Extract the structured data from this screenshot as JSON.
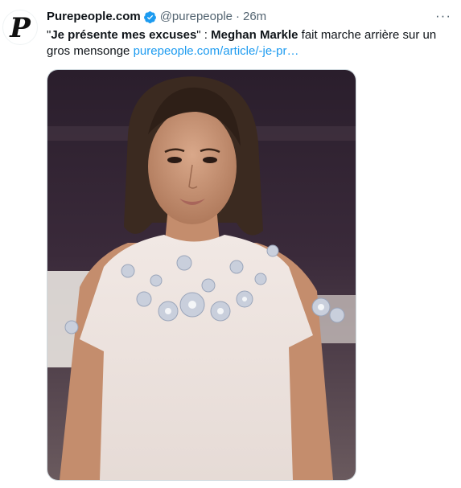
{
  "author": {
    "avatar_letter": "P",
    "display_name": "Purepeople.com",
    "handle": "@purepeople",
    "separator": "·",
    "timestamp": "26m",
    "verified_icon": "verified-badge-icon"
  },
  "more_icon": "more-options-icon",
  "tweet": {
    "quote_open": "\"",
    "quote_text": "Je présente mes excuses",
    "quote_close": "\" : ",
    "name": "Meghan Markle",
    "body": " fait marche arrière sur un gros mensonge ",
    "link": "purepeople.com/article/-je-pr…"
  },
  "colors": {
    "accent": "#1d9bf0",
    "text": "#0f1419",
    "secondary": "#536471"
  }
}
